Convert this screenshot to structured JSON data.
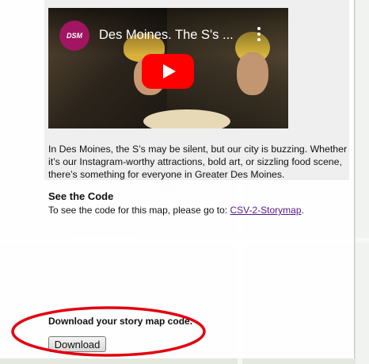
{
  "video": {
    "channel_logo_text": "DSM",
    "title": "Des Moines. The S's ...",
    "play_icon": "youtube-play-icon",
    "menu_icon": "more-vert-icon"
  },
  "description": "In Des Moines, the S’s may be silent, but our city is buzzing. Whether it’s our Instagram-worthy attractions, bold art, or sizzling food scene, there’s something for everyone in Greater Des Moines.",
  "see_code": {
    "heading": "See the Code",
    "prefix": "To see the code for this map, please go to: ",
    "link_text": "CSV-2-Storymap",
    "suffix": "."
  },
  "download": {
    "label": "Download your story map code.",
    "button_label": "Download"
  },
  "colors": {
    "annotation": "#e3000f",
    "link": "#551a8b",
    "play": "#ff0000",
    "channel_logo": "#a11562"
  }
}
